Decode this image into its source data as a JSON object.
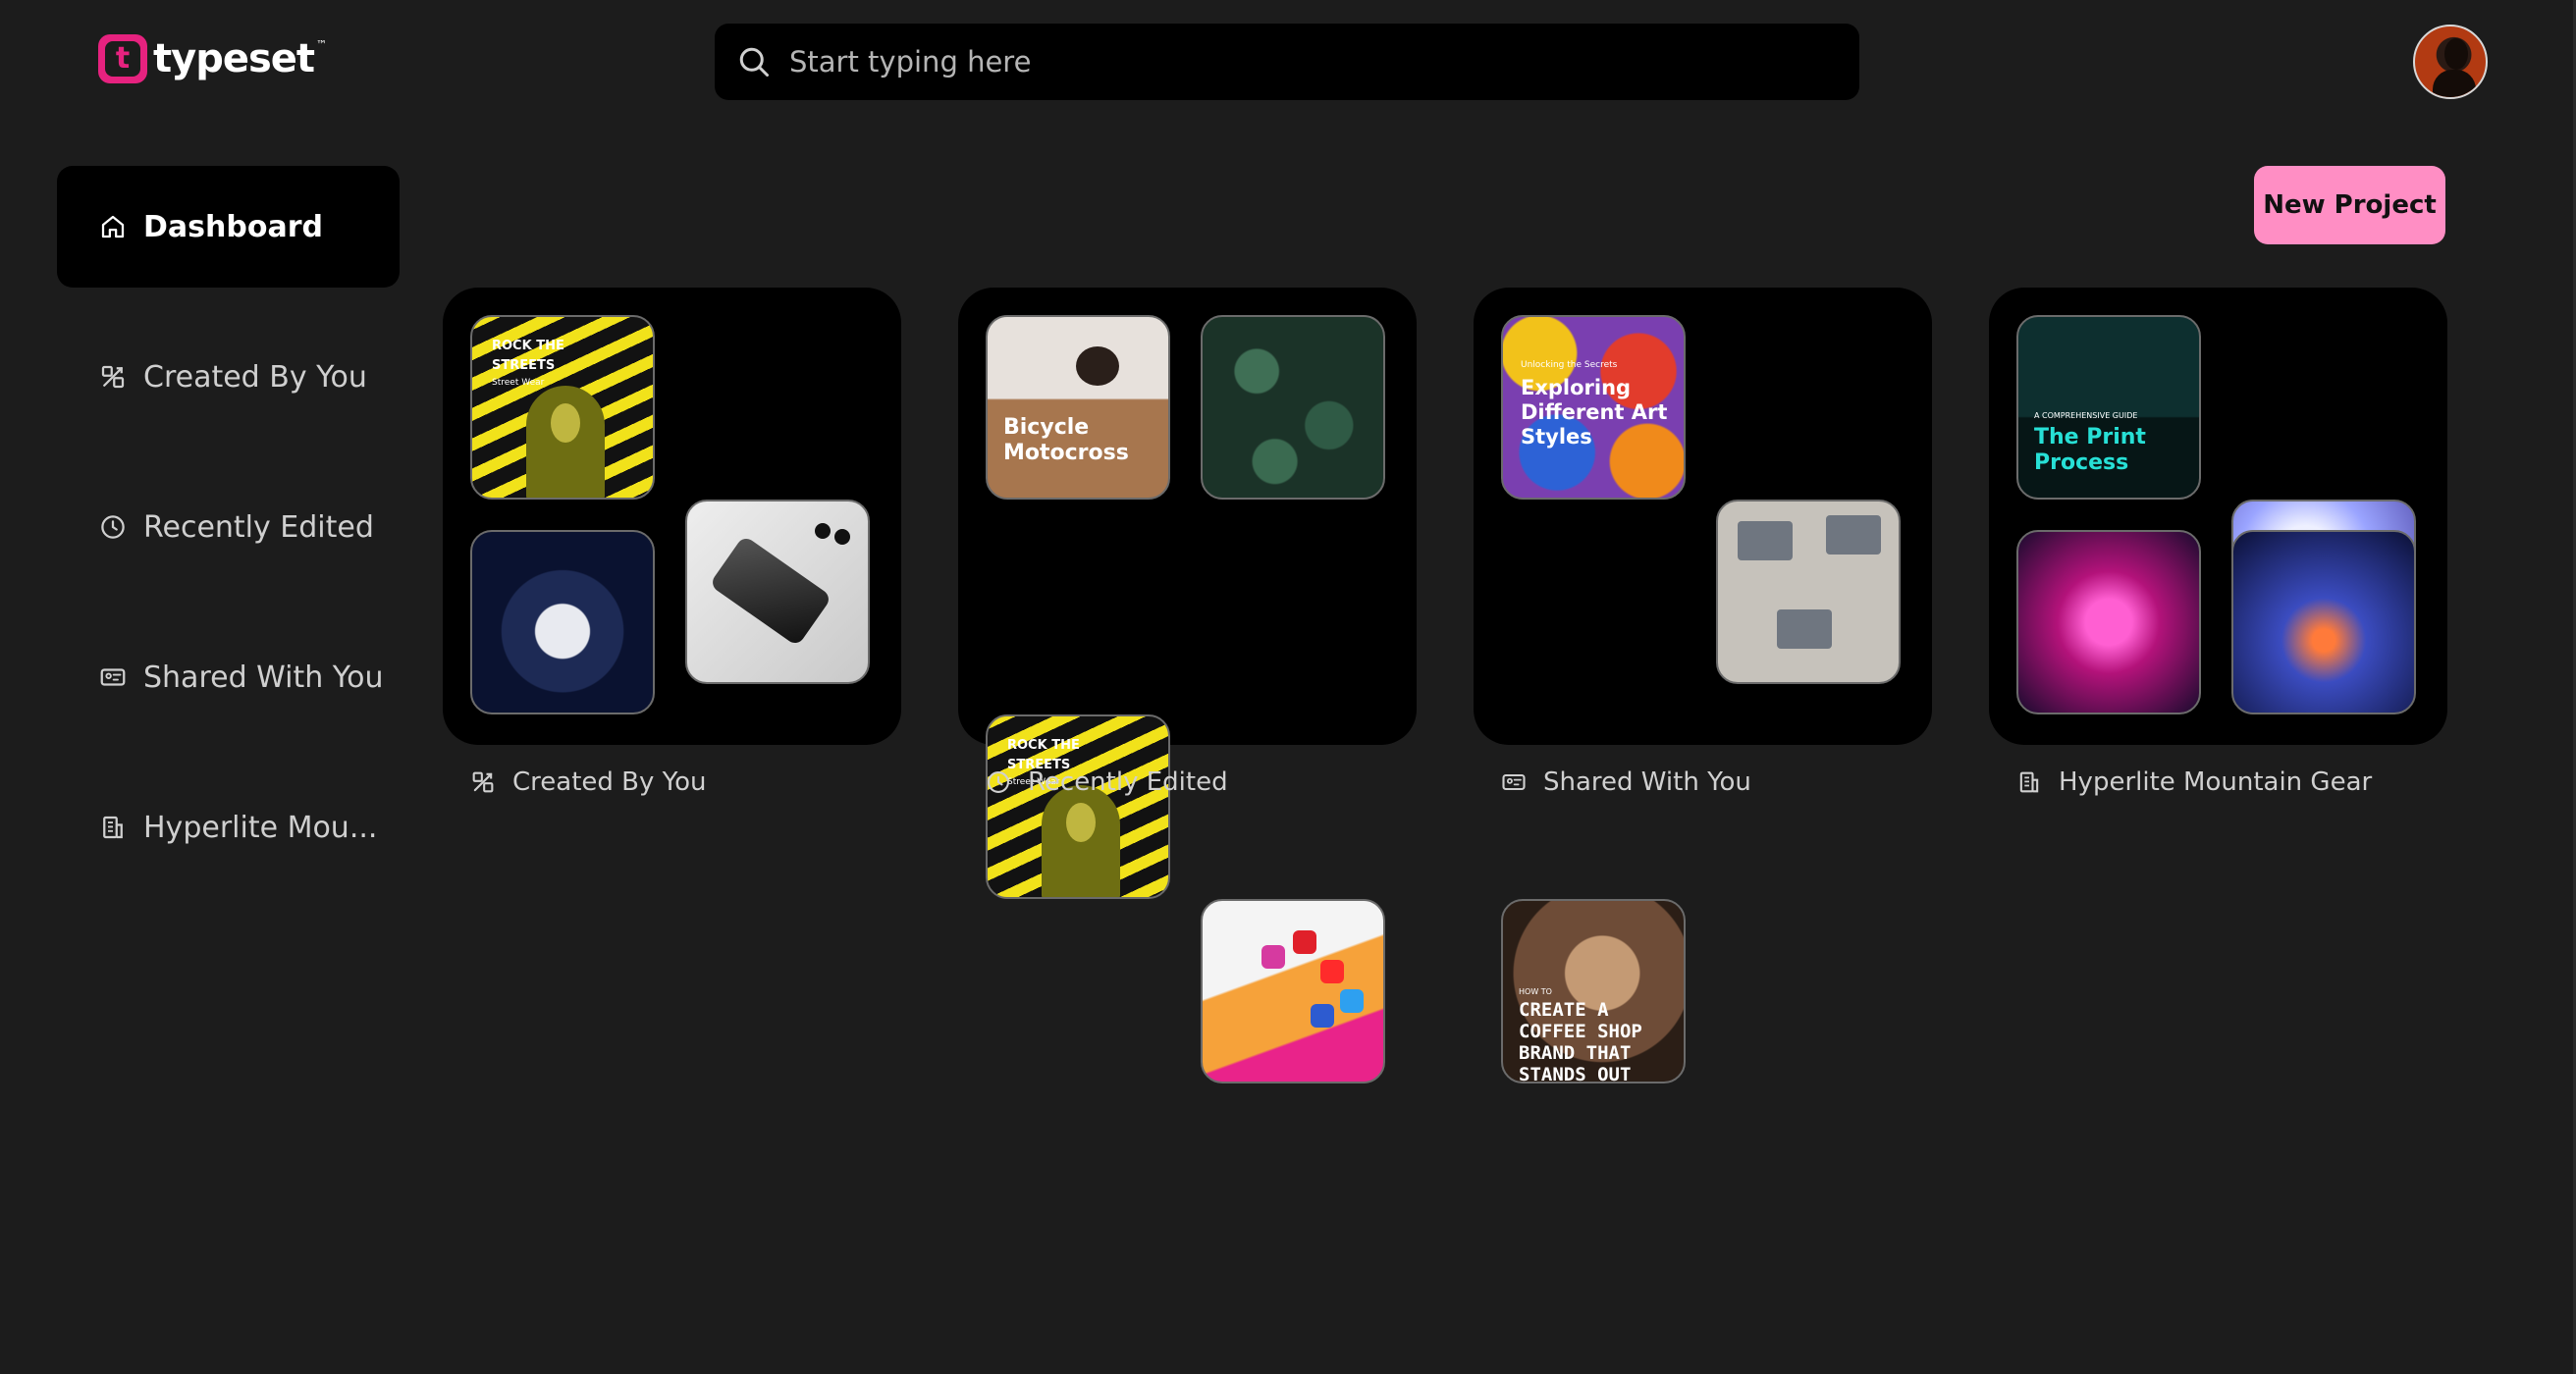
{
  "app": {
    "brand": "typeset",
    "trademark": "™",
    "logo_letter": "t"
  },
  "search": {
    "placeholder": "Start typing here"
  },
  "sidebar": {
    "items": [
      {
        "label": "Dashboard",
        "icon": "home-icon",
        "active": true
      },
      {
        "label": "Created By You",
        "icon": "design-tools-icon",
        "active": false
      },
      {
        "label": "Recently Edited",
        "icon": "clock-icon",
        "active": false
      },
      {
        "label": "Shared With You",
        "icon": "shared-id-icon",
        "active": false
      },
      {
        "label": "Hyperlite Mou...",
        "icon": "building-icon",
        "active": false
      }
    ]
  },
  "toolbar": {
    "new_project_label": "New Project"
  },
  "cards": [
    {
      "label": "Created By You",
      "icon": "design-tools-icon",
      "thumbnails": [
        {
          "title": "ROCK THE STREETS",
          "subtitle": "Street Wear"
        },
        {
          "title": ""
        },
        {
          "title": ""
        }
      ]
    },
    {
      "label": "Recently Edited",
      "icon": "clock-icon",
      "thumbnails": [
        {
          "title": "Bicycle Motocross"
        },
        {
          "title": ""
        },
        {
          "title": "ROCK THE STREETS",
          "subtitle": "Street Wear"
        },
        {
          "title": ""
        }
      ]
    },
    {
      "label": "Shared With You",
      "icon": "shared-id-icon",
      "thumbnails": [
        {
          "pretitle": "Unlocking the Secrets",
          "title": "Exploring Different Art Styles"
        },
        {
          "title": ""
        },
        {
          "pretitle": "HOW TO",
          "title": "CREATE A COFFEE SHOP BRAND THAT STANDS OUT"
        }
      ]
    },
    {
      "label": "Hyperlite Mountain Gear",
      "icon": "building-icon",
      "thumbnails": [
        {
          "pretitle": "A COMPREHENSIVE GUIDE",
          "title": "The Print Process"
        },
        {
          "title": ""
        },
        {
          "title": ""
        },
        {
          "title": ""
        }
      ]
    }
  ],
  "colors": {
    "background": "#1c1c1c",
    "panel": "#000000",
    "brand_pink": "#e6227f",
    "button_pink": "#ff8ec4"
  }
}
